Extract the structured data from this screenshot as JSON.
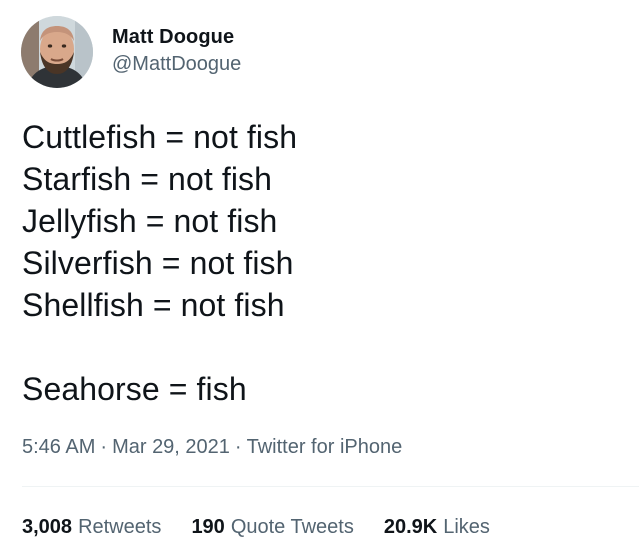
{
  "author": {
    "display_name": "Matt Doogue",
    "handle": "@MattDoogue"
  },
  "tweet": {
    "lines": [
      "Cuttlefish = not fish",
      "Starfish = not fish",
      "Jellyfish = not fish",
      "Silverfish = not fish",
      "Shellfish = not fish",
      "",
      "Seahorse = fish"
    ]
  },
  "meta": {
    "time": "5:46 AM",
    "date": "Mar 29, 2021",
    "source": "Twitter for iPhone",
    "separator": "·"
  },
  "stats": {
    "retweets": {
      "count": "3,008",
      "label": "Retweets"
    },
    "quote_tweets": {
      "count": "190",
      "label": "Quote Tweets"
    },
    "likes": {
      "count": "20.9K",
      "label": "Likes"
    }
  },
  "colors": {
    "text_primary": "#0f1419",
    "text_secondary": "#536471",
    "divider": "#eff3f4"
  },
  "icons": {
    "avatar": "profile-photo"
  }
}
